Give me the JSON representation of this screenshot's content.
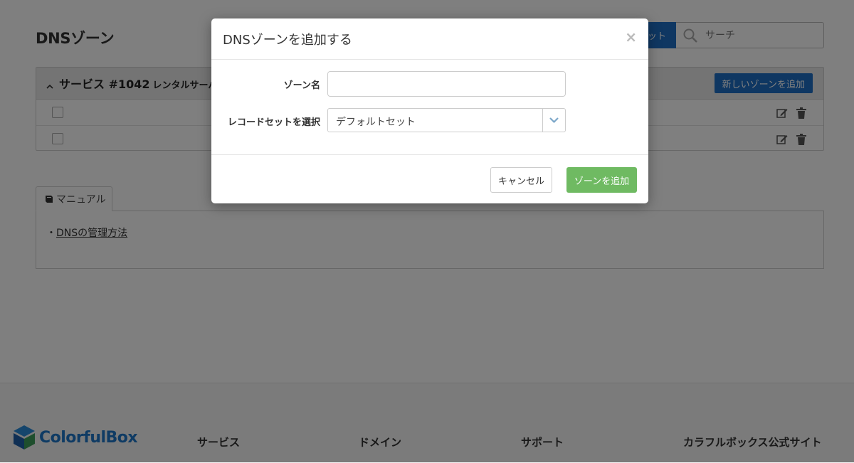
{
  "page": {
    "title": "DNSゾーン"
  },
  "toolbar": {
    "preset_label": "ット",
    "search_placeholder": "サーチ"
  },
  "service_panel": {
    "title": "サービス #1042",
    "subtitle": "レンタルサーバー",
    "new_zone_button": "新しいゾーンを追加",
    "rows": 2
  },
  "manual": {
    "tab_label": "マニュアル",
    "bullet": "・",
    "link_text": "DNSの管理方法"
  },
  "footer": {
    "brand": "ColorfulBox",
    "columns": [
      "サービス",
      "ドメイン",
      "サポート",
      "カラフルボックス公式サイト"
    ]
  },
  "modal": {
    "title": "DNSゾーンを追加する",
    "close_label": "×",
    "zone_name_label": "ゾーン名",
    "zone_name_value": "",
    "record_set_label": "レコードセットを選択",
    "record_set_selected": "デフォルトセット",
    "cancel_label": "キャンセル",
    "add_label": "ゾーンを追加"
  },
  "colors": {
    "primary": "#1f6fc5",
    "success": "#6fba62",
    "overlay": "rgba(0,0,0,0.5)"
  }
}
